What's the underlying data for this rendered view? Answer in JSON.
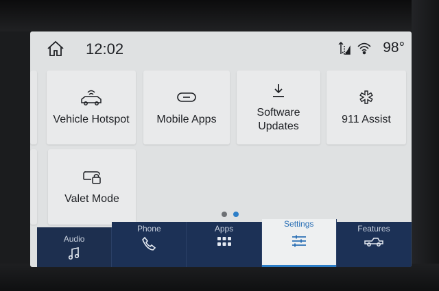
{
  "status": {
    "time": "12:02",
    "temperature": "98°",
    "icons": [
      "home-icon",
      "data-transfer-icon",
      "wifi-hotspot-icon"
    ]
  },
  "tiles": [
    {
      "label": "Vehicle Hotspot",
      "icon": "car-wifi-icon"
    },
    {
      "label": "Mobile Apps",
      "icon": "link-icon"
    },
    {
      "label_line1": "Software",
      "label_line2": "Updates",
      "icon": "download-icon"
    },
    {
      "label": "911 Assist",
      "icon": "asterisk-icon"
    },
    {
      "label": "Valet Mode",
      "icon": "car-lock-icon"
    }
  ],
  "pagination": {
    "pages": 2,
    "current": 2
  },
  "nav": [
    {
      "label": "Audio",
      "icon": "music-note-icon"
    },
    {
      "label": "Phone",
      "icon": "phone-icon"
    },
    {
      "label": "Apps",
      "icon": "apps-grid-icon"
    },
    {
      "label": "Settings",
      "icon": "sliders-icon",
      "active": true
    },
    {
      "label": "Features",
      "icon": "truck-icon"
    }
  ],
  "colors": {
    "screen_bg": "#dfe1e2",
    "tile_bg": "#e9eaeb",
    "nav_bg": "#1d2f4f",
    "accent": "#2c7ec8"
  }
}
